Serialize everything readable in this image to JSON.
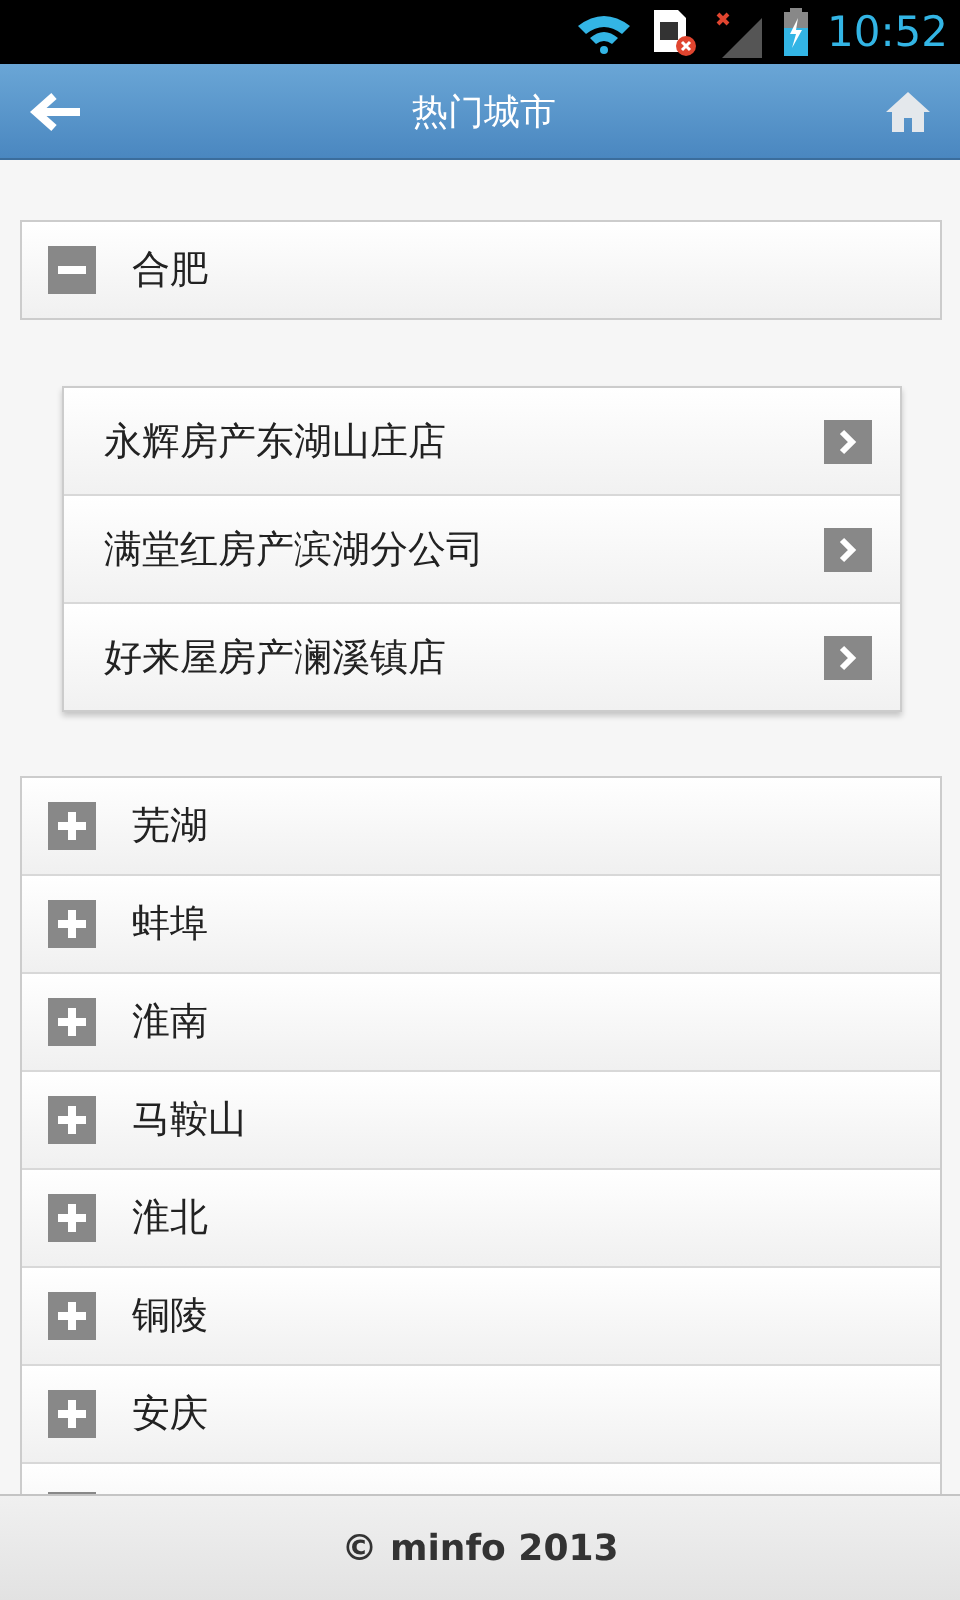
{
  "status_bar": {
    "time": "10:52"
  },
  "header": {
    "title": "热门城市"
  },
  "cities": [
    {
      "name": "合肥",
      "expanded": true,
      "stores": [
        "永辉房产东湖山庄店",
        "满堂红房产滨湖分公司",
        "好来屋房产澜溪镇店"
      ]
    },
    {
      "name": "芜湖",
      "expanded": false
    },
    {
      "name": "蚌埠",
      "expanded": false
    },
    {
      "name": "淮南",
      "expanded": false
    },
    {
      "name": "马鞍山",
      "expanded": false
    },
    {
      "name": "淮北",
      "expanded": false
    },
    {
      "name": "铜陵",
      "expanded": false
    },
    {
      "name": "安庆",
      "expanded": false
    }
  ],
  "footer": {
    "text": "© minfo 2013"
  }
}
